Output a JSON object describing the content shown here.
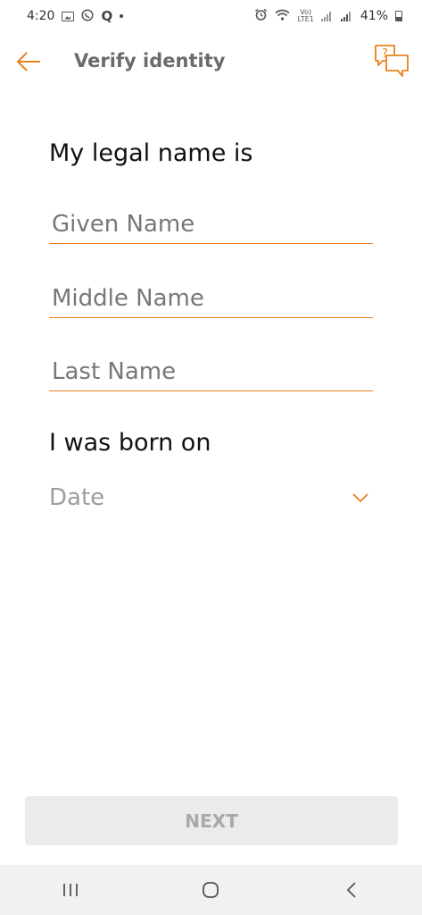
{
  "status_bar": {
    "time": "4:20",
    "battery_percent": "41%",
    "network_label": "LTE1",
    "left_icons": [
      "image-icon",
      "viber-icon",
      "q-icon",
      "dot-icon"
    ],
    "right_icons": [
      "alarm-icon",
      "wifi-icon",
      "volte-icon",
      "signal-icon",
      "signal-icon",
      "battery-icon"
    ]
  },
  "app_bar": {
    "title": "Verify identity",
    "back_icon": "arrow-left-icon",
    "help_icon": "chat-question-icon",
    "accent_color": "#e8821f"
  },
  "form": {
    "name_heading": "My legal name is",
    "given_name": {
      "placeholder": "Given Name",
      "value": ""
    },
    "middle_name": {
      "placeholder": "Middle Name",
      "value": ""
    },
    "last_name": {
      "placeholder": "Last Name",
      "value": ""
    },
    "dob_heading": "I was born on",
    "date": {
      "placeholder": "Date",
      "value": ""
    }
  },
  "next_button": {
    "label": "NEXT",
    "enabled": false
  },
  "nav_bar": {
    "icons": [
      "recents-icon",
      "home-icon",
      "back-icon"
    ]
  }
}
